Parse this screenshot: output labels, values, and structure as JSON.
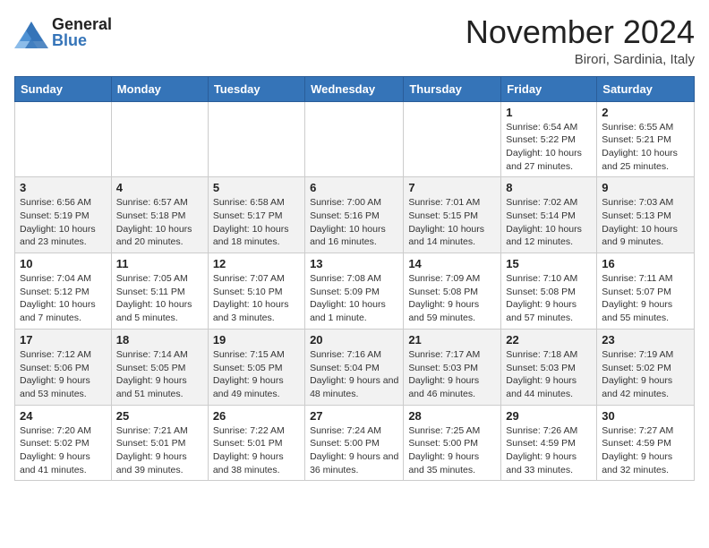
{
  "header": {
    "logo_general": "General",
    "logo_blue": "Blue",
    "month_title": "November 2024",
    "location": "Birori, Sardinia, Italy"
  },
  "weekdays": [
    "Sunday",
    "Monday",
    "Tuesday",
    "Wednesday",
    "Thursday",
    "Friday",
    "Saturday"
  ],
  "weeks": [
    [
      {
        "day": "",
        "info": ""
      },
      {
        "day": "",
        "info": ""
      },
      {
        "day": "",
        "info": ""
      },
      {
        "day": "",
        "info": ""
      },
      {
        "day": "",
        "info": ""
      },
      {
        "day": "1",
        "info": "Sunrise: 6:54 AM\nSunset: 5:22 PM\nDaylight: 10 hours and 27 minutes."
      },
      {
        "day": "2",
        "info": "Sunrise: 6:55 AM\nSunset: 5:21 PM\nDaylight: 10 hours and 25 minutes."
      }
    ],
    [
      {
        "day": "3",
        "info": "Sunrise: 6:56 AM\nSunset: 5:19 PM\nDaylight: 10 hours and 23 minutes."
      },
      {
        "day": "4",
        "info": "Sunrise: 6:57 AM\nSunset: 5:18 PM\nDaylight: 10 hours and 20 minutes."
      },
      {
        "day": "5",
        "info": "Sunrise: 6:58 AM\nSunset: 5:17 PM\nDaylight: 10 hours and 18 minutes."
      },
      {
        "day": "6",
        "info": "Sunrise: 7:00 AM\nSunset: 5:16 PM\nDaylight: 10 hours and 16 minutes."
      },
      {
        "day": "7",
        "info": "Sunrise: 7:01 AM\nSunset: 5:15 PM\nDaylight: 10 hours and 14 minutes."
      },
      {
        "day": "8",
        "info": "Sunrise: 7:02 AM\nSunset: 5:14 PM\nDaylight: 10 hours and 12 minutes."
      },
      {
        "day": "9",
        "info": "Sunrise: 7:03 AM\nSunset: 5:13 PM\nDaylight: 10 hours and 9 minutes."
      }
    ],
    [
      {
        "day": "10",
        "info": "Sunrise: 7:04 AM\nSunset: 5:12 PM\nDaylight: 10 hours and 7 minutes."
      },
      {
        "day": "11",
        "info": "Sunrise: 7:05 AM\nSunset: 5:11 PM\nDaylight: 10 hours and 5 minutes."
      },
      {
        "day": "12",
        "info": "Sunrise: 7:07 AM\nSunset: 5:10 PM\nDaylight: 10 hours and 3 minutes."
      },
      {
        "day": "13",
        "info": "Sunrise: 7:08 AM\nSunset: 5:09 PM\nDaylight: 10 hours and 1 minute."
      },
      {
        "day": "14",
        "info": "Sunrise: 7:09 AM\nSunset: 5:08 PM\nDaylight: 9 hours and 59 minutes."
      },
      {
        "day": "15",
        "info": "Sunrise: 7:10 AM\nSunset: 5:08 PM\nDaylight: 9 hours and 57 minutes."
      },
      {
        "day": "16",
        "info": "Sunrise: 7:11 AM\nSunset: 5:07 PM\nDaylight: 9 hours and 55 minutes."
      }
    ],
    [
      {
        "day": "17",
        "info": "Sunrise: 7:12 AM\nSunset: 5:06 PM\nDaylight: 9 hours and 53 minutes."
      },
      {
        "day": "18",
        "info": "Sunrise: 7:14 AM\nSunset: 5:05 PM\nDaylight: 9 hours and 51 minutes."
      },
      {
        "day": "19",
        "info": "Sunrise: 7:15 AM\nSunset: 5:05 PM\nDaylight: 9 hours and 49 minutes."
      },
      {
        "day": "20",
        "info": "Sunrise: 7:16 AM\nSunset: 5:04 PM\nDaylight: 9 hours and 48 minutes."
      },
      {
        "day": "21",
        "info": "Sunrise: 7:17 AM\nSunset: 5:03 PM\nDaylight: 9 hours and 46 minutes."
      },
      {
        "day": "22",
        "info": "Sunrise: 7:18 AM\nSunset: 5:03 PM\nDaylight: 9 hours and 44 minutes."
      },
      {
        "day": "23",
        "info": "Sunrise: 7:19 AM\nSunset: 5:02 PM\nDaylight: 9 hours and 42 minutes."
      }
    ],
    [
      {
        "day": "24",
        "info": "Sunrise: 7:20 AM\nSunset: 5:02 PM\nDaylight: 9 hours and 41 minutes."
      },
      {
        "day": "25",
        "info": "Sunrise: 7:21 AM\nSunset: 5:01 PM\nDaylight: 9 hours and 39 minutes."
      },
      {
        "day": "26",
        "info": "Sunrise: 7:22 AM\nSunset: 5:01 PM\nDaylight: 9 hours and 38 minutes."
      },
      {
        "day": "27",
        "info": "Sunrise: 7:24 AM\nSunset: 5:00 PM\nDaylight: 9 hours and 36 minutes."
      },
      {
        "day": "28",
        "info": "Sunrise: 7:25 AM\nSunset: 5:00 PM\nDaylight: 9 hours and 35 minutes."
      },
      {
        "day": "29",
        "info": "Sunrise: 7:26 AM\nSunset: 4:59 PM\nDaylight: 9 hours and 33 minutes."
      },
      {
        "day": "30",
        "info": "Sunrise: 7:27 AM\nSunset: 4:59 PM\nDaylight: 9 hours and 32 minutes."
      }
    ]
  ],
  "accent_color": "#3574b8"
}
